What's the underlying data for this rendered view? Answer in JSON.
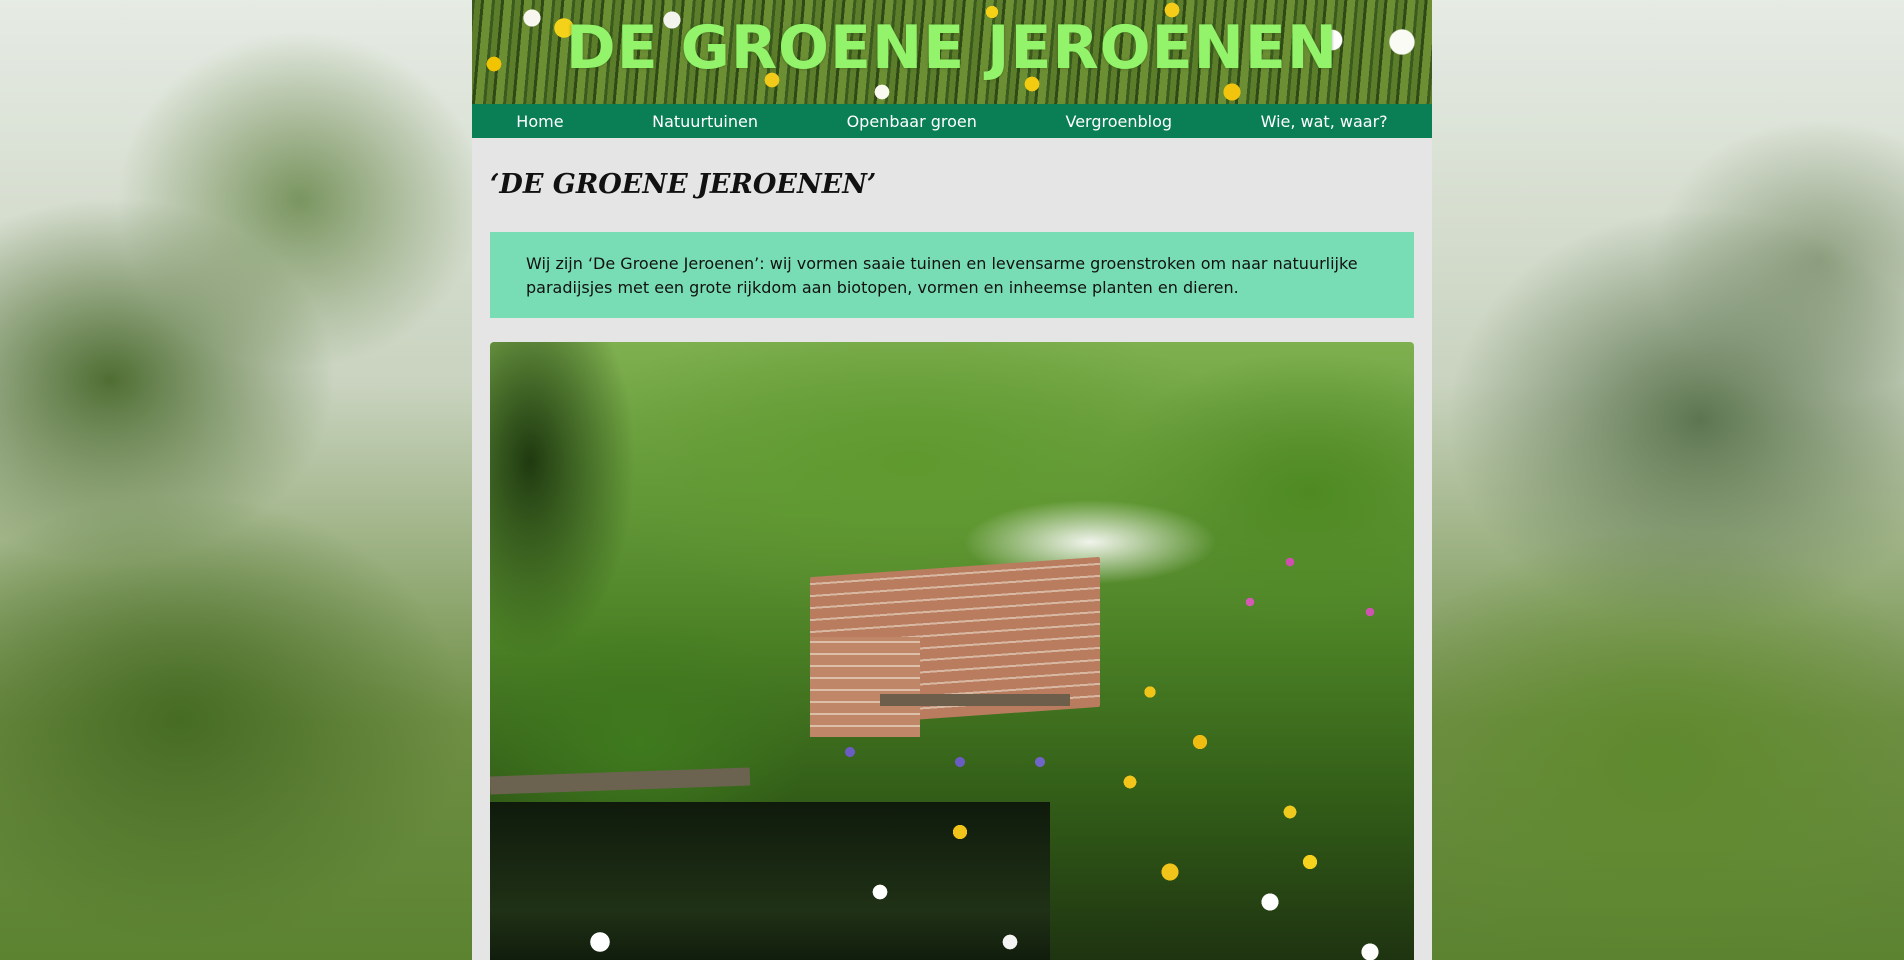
{
  "site": {
    "banner_title": "DE GROENE JEROENEN"
  },
  "nav": {
    "items": [
      {
        "label": "Home"
      },
      {
        "label": "Natuurtuinen"
      },
      {
        "label": "Openbaar groen"
      },
      {
        "label": "Vergroenblog"
      },
      {
        "label": "Wie, wat, waar?"
      }
    ]
  },
  "main": {
    "heading": "‘DE GROENE JEROENEN’",
    "intro": "Wij zijn ‘De Groene Jeroenen’: wij vormen saaie tuinen en levensarme groenstroken om naar natuurlijke paradijsjes met een grote rijkdom aan biotopen, vormen en inheemse planten en dieren."
  },
  "colors": {
    "nav_bg": "#0a7f55",
    "banner_text": "#93f36a",
    "intro_bg": "#78ddb5",
    "page_bg": "#e5e5e5"
  }
}
